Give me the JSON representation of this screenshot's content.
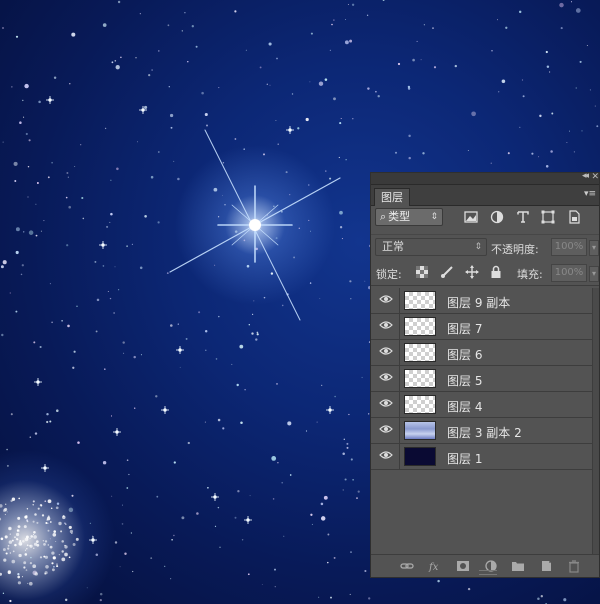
{
  "panel": {
    "tab_label": "图层",
    "filter": {
      "kind_label": "类型",
      "search_glyph": "⌕",
      "arrows": "⇕"
    },
    "blend_mode": "正常",
    "opacity_label": "不透明度:",
    "opacity_value": "100%",
    "lock_label": "锁定:",
    "fill_label": "填充:",
    "fill_value": "100%",
    "collapse_glyph": "◂◂",
    "close_glyph": "✕",
    "menu_glyph": "▾≡"
  },
  "layers": [
    {
      "name": "图层 9 副本",
      "visible": true,
      "thumb": "transparent"
    },
    {
      "name": "图层 7",
      "visible": true,
      "thumb": "transparent"
    },
    {
      "name": "图层 6",
      "visible": true,
      "thumb": "transparent"
    },
    {
      "name": "图层 5",
      "visible": true,
      "thumb": "transparent"
    },
    {
      "name": "图层 4",
      "visible": true,
      "thumb": "transparent"
    },
    {
      "name": "图层 3 副本 2",
      "visible": true,
      "thumb": "stars"
    },
    {
      "name": "图层 1",
      "visible": true,
      "thumb": "dark-blue"
    }
  ],
  "icons": {
    "filter": [
      "image-filter-icon",
      "adjustment-filter-icon",
      "type-filter-icon",
      "shape-filter-icon",
      "smart-object-filter-icon"
    ],
    "lock": [
      "lock-transparent-pixels-icon",
      "lock-image-pixels-icon",
      "lock-position-icon",
      "lock-all-icon"
    ],
    "bottom": [
      "link-layers-icon",
      "fx-icon",
      "add-mask-icon",
      "new-adjustment-layer-icon",
      "new-group-icon",
      "new-layer-icon",
      "delete-layer-icon"
    ]
  },
  "colors": {
    "panel_bg": "#535353",
    "canvas_sky": "#0c2775"
  }
}
